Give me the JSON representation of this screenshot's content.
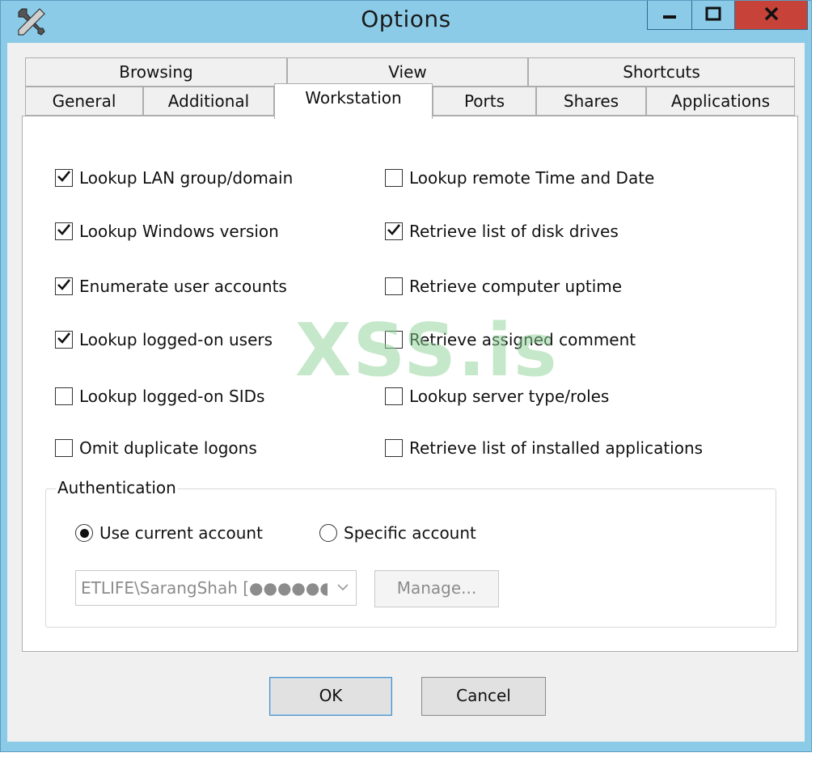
{
  "window": {
    "title": "Options",
    "icon": "tools-icon",
    "controls": [
      "minimize-icon",
      "maximize-icon",
      "close-icon"
    ]
  },
  "tabs": {
    "row1": [
      "Browsing",
      "View",
      "Shortcuts"
    ],
    "row2": [
      "General",
      "Additional",
      "Workstation",
      "Ports",
      "Shares",
      "Applications"
    ],
    "active": "Workstation"
  },
  "checkboxes": {
    "left": [
      {
        "label": "Lookup LAN group/domain",
        "checked": true
      },
      {
        "label": "Lookup Windows version",
        "checked": true
      },
      {
        "label": "Enumerate user accounts",
        "checked": true
      },
      {
        "label": "Lookup logged-on users",
        "checked": true
      },
      {
        "label": "Lookup logged-on SIDs",
        "checked": false
      },
      {
        "label": "Omit duplicate logons",
        "checked": false
      }
    ],
    "right": [
      {
        "label": "Lookup remote Time and Date",
        "checked": false
      },
      {
        "label": "Retrieve list of disk drives",
        "checked": true
      },
      {
        "label": "Retrieve computer uptime",
        "checked": false
      },
      {
        "label": "Retrieve assigned comment",
        "checked": false
      },
      {
        "label": "Lookup server type/roles",
        "checked": false
      },
      {
        "label": "Retrieve list of installed applications",
        "checked": false
      }
    ]
  },
  "authentication": {
    "legend": "Authentication",
    "options": [
      {
        "label": "Use current account",
        "selected": true
      },
      {
        "label": "Specific account",
        "selected": false
      }
    ],
    "account_value": "ETLIFE\\SarangShah [●●●●●●●●",
    "manage_label": "Manage..."
  },
  "buttons": {
    "ok": "OK",
    "cancel": "Cancel"
  },
  "watermark": "XSS.is",
  "colors": {
    "frame": "#8ccbe8",
    "close": "#c7433a"
  }
}
